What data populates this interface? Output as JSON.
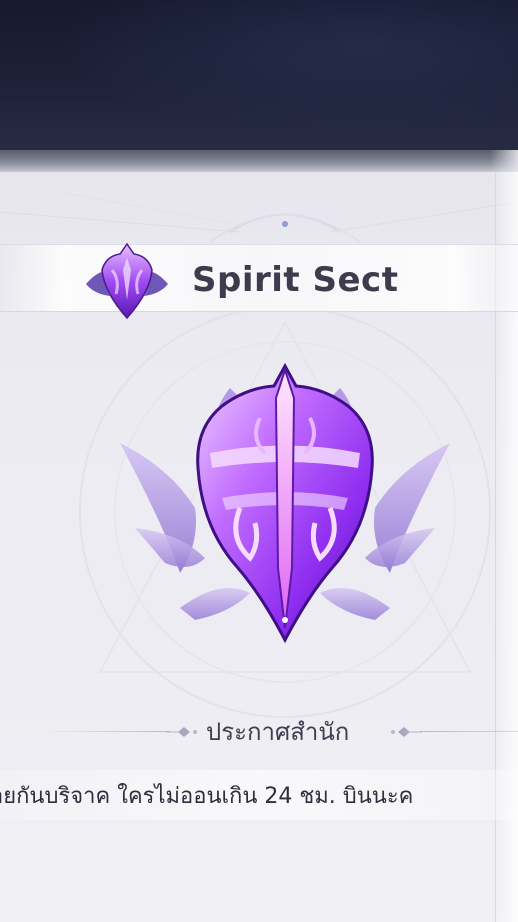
{
  "sect": {
    "name": "Spirit Sect",
    "icon": "purple-sect-crest-icon",
    "emblem": "purple-sect-emblem-large"
  },
  "announcement": {
    "title": "ประกาศสำนัก",
    "text": "อยกันบริจาค ใครไม่ออนเกิน 24 ชม. บินนะค"
  },
  "colors": {
    "emblem_primary": "#a24cf2",
    "emblem_light": "#e6b6ff",
    "emblem_dark": "#5a17b5",
    "emblem_wing": "#b9a3e3",
    "title_text": "#3d3c4d",
    "top_band": "#1b1f36"
  }
}
